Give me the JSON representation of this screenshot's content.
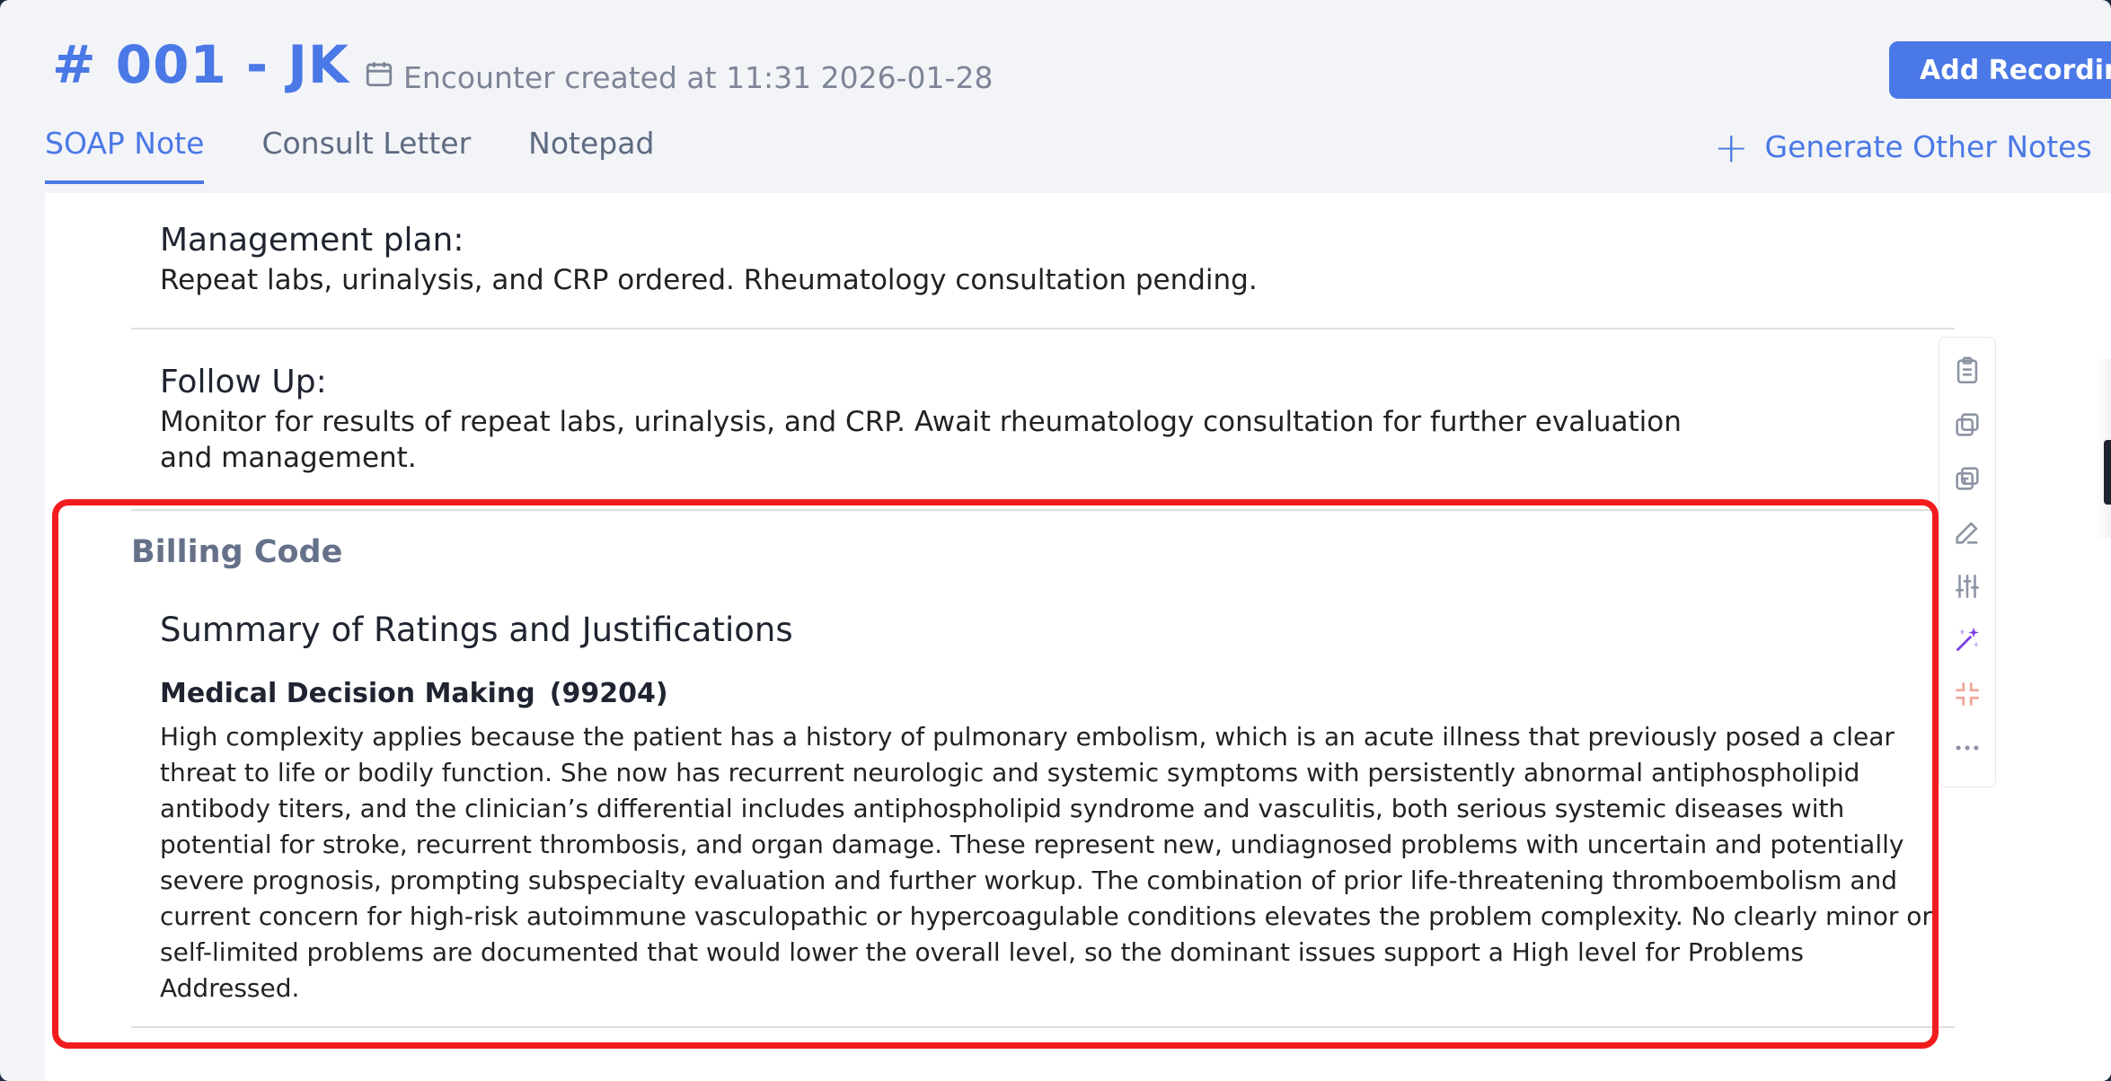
{
  "header": {
    "encounter_title": "# 001 - JK",
    "encounter_meta": "Encounter created at 11:31 2026-01-28",
    "add_recording_label": "Add Recording"
  },
  "tabs": [
    {
      "label": "SOAP Note",
      "active": true
    },
    {
      "label": "Consult Letter",
      "active": false
    },
    {
      "label": "Notepad",
      "active": false
    }
  ],
  "generate_other_notes_label": "Generate Other Notes",
  "note": {
    "management_plan": {
      "title": "Management plan:",
      "text": "Repeat labs, urinalysis, and CRP ordered. Rheumatology consultation pending."
    },
    "follow_up": {
      "title": "Follow Up:",
      "text": "Monitor for results of repeat labs, urinalysis, and CRP. Await rheumatology consultation for further evaluation and management."
    }
  },
  "billing": {
    "label": "Billing Code",
    "summary_title": "Summary of Ratings and Justifications",
    "mdm_title": "Medical Decision Making",
    "mdm_code": "(99204)",
    "mdm_text": "High complexity applies because the patient has a history of pulmonary embolism, which is an acute illness that previously posed a clear threat to life or bodily function. She now has recurrent neurologic and systemic symptoms with persistently abnormal antiphospholipid antibody titers, and the clinician’s differential includes antiphospholipid syndrome and vasculitis, both serious systemic diseases with potential for stroke, recurrent thrombosis, and organ damage. These represent new, undiagnosed problems with uncertain and potentially severe prognosis, prompting subspecialty evaluation and further workup. The combination of prior life-threatening thromboembolism and current concern for high-risk autoimmune vasculopathic or hypercoagulable conditions elevates the problem complexity. No clearly minor or self-limited problems are documented that would lower the overall level, so the dominant issues support a High level for Problems Addressed."
  },
  "toolbar_icons": [
    "clipboard-icon",
    "copy-icon",
    "copy-text-icon",
    "edit-icon",
    "sliders-icon",
    "magic-wand-icon",
    "collapse-icon",
    "more-icon"
  ],
  "colors": {
    "accent": "#4a78e6",
    "highlight": "#f21c1c",
    "magic": "#7b3fe4",
    "collapse": "#f0a89a"
  }
}
